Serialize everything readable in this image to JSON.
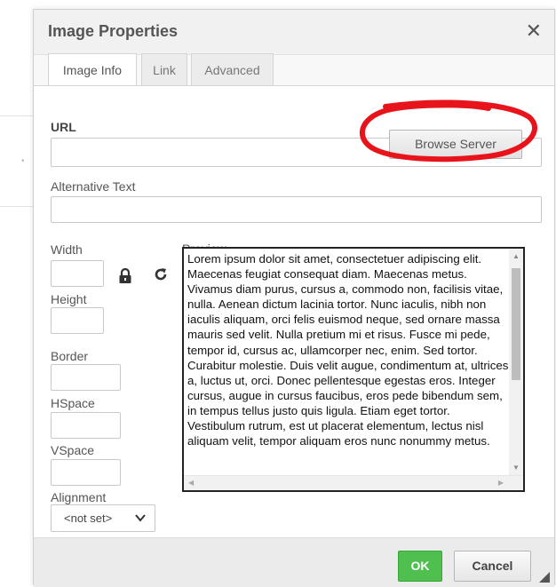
{
  "dialog": {
    "title": "Image Properties",
    "close_glyph": "✕"
  },
  "tabs": [
    {
      "label": "Image Info",
      "active": true
    },
    {
      "label": "Link",
      "active": false
    },
    {
      "label": "Advanced",
      "active": false
    }
  ],
  "fields": {
    "url_label": "URL",
    "url_value": "",
    "browse_label": "Browse Server",
    "alt_label": "Alternative Text",
    "alt_value": "",
    "width_label": "Width",
    "height_label": "Height",
    "border_label": "Border",
    "hspace_label": "HSpace",
    "vspace_label": "VSpace",
    "alignment_label": "Alignment",
    "alignment_value": "<not set>"
  },
  "preview": {
    "label": "Preview",
    "text": "Lorem ipsum dolor sit amet, consectetuer adipiscing elit. Maecenas feugiat consequat diam. Maecenas metus. Vivamus diam purus, cursus a, commodo non, facilisis vitae, nulla. Aenean dictum lacinia tortor. Nunc iaculis, nibh non iaculis aliquam, orci felis euismod neque, sed ornare massa mauris sed velit. Nulla pretium mi et risus. Fusce mi pede, tempor id, cursus ac, ullamcorper nec, enim. Sed tortor. Curabitur molestie. Duis velit augue, condimentum at, ultrices a, luctus ut, orci. Donec pellentesque egestas eros. Integer cursus, augue in cursus faucibus, eros pede bibendum sem, in tempus tellus justo quis ligula. Etiam eget tortor. Vestibulum rutrum, est ut placerat elementum, lectus nisl aliquam velit, tempor aliquam eros nunc nonummy metus."
  },
  "footer": {
    "ok_label": "OK",
    "cancel_label": "Cancel"
  },
  "icons": {
    "lock": "lock-icon",
    "reset": "reset-size-icon",
    "close": "close-icon",
    "chevron": "chevron-down-icon"
  },
  "colors": {
    "ok_green": "#4fc04f",
    "annotation_red": "#e8141b"
  }
}
